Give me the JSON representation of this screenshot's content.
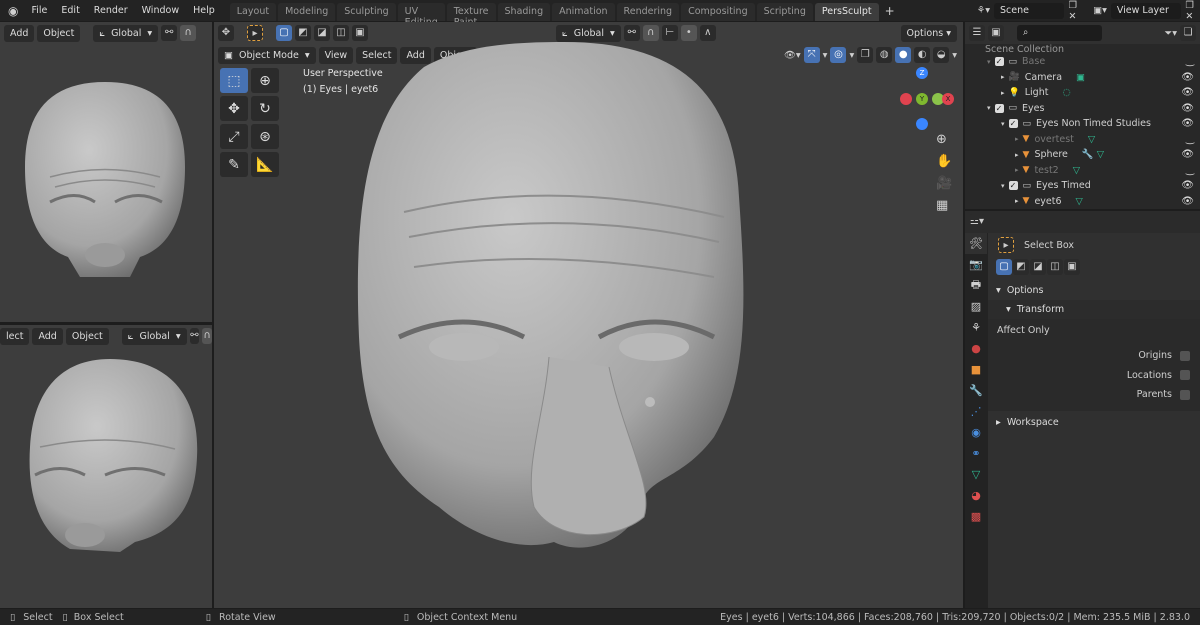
{
  "topbar": {
    "menus": [
      "File",
      "Edit",
      "Render",
      "Window",
      "Help"
    ],
    "workspaces": [
      "Layout",
      "Modeling",
      "Sculpting",
      "UV Editing",
      "Texture Paint",
      "Shading",
      "Animation",
      "Rendering",
      "Compositing",
      "Scripting",
      "PersSculpt"
    ],
    "active_workspace": "PersSculpt",
    "scene": "Scene",
    "view_layer": "View Layer"
  },
  "left_top": {
    "menus": [
      "Add",
      "Object"
    ],
    "orientation": "Global"
  },
  "left_bottom": {
    "menus": [
      "lect",
      "Add",
      "Object"
    ],
    "orientation": "Global"
  },
  "main": {
    "mode": "Object Mode",
    "menus": [
      "View",
      "Select",
      "Add",
      "Object"
    ],
    "orientation": "Global",
    "options": "Options",
    "overlay_title": "User Perspective",
    "overlay_sub": "(1) Eyes | eyet6",
    "gizmo": {
      "x": "X",
      "y": "Y",
      "z": "Z"
    }
  },
  "outliner": {
    "root": "Scene Collection",
    "items": [
      {
        "label": "Base",
        "depth": 1,
        "type": "collection",
        "dim": true,
        "visible": false
      },
      {
        "label": "Camera",
        "depth": 2,
        "type": "camera",
        "dim": false,
        "visible": true
      },
      {
        "label": "Light",
        "depth": 2,
        "type": "light",
        "dim": false,
        "visible": true
      },
      {
        "label": "Eyes",
        "depth": 1,
        "type": "collection",
        "dim": false,
        "visible": true
      },
      {
        "label": "Eyes Non Timed Studies",
        "depth": 2,
        "type": "collection",
        "dim": false,
        "visible": true
      },
      {
        "label": "overtest",
        "depth": 3,
        "type": "mesh",
        "dim": true,
        "visible": false
      },
      {
        "label": "Sphere",
        "depth": 3,
        "type": "mesh",
        "dim": false,
        "visible": true
      },
      {
        "label": "test2",
        "depth": 3,
        "type": "mesh",
        "dim": true,
        "visible": false
      },
      {
        "label": "Eyes Timed",
        "depth": 2,
        "type": "collection",
        "dim": false,
        "visible": true
      },
      {
        "label": "eyet6",
        "depth": 3,
        "type": "mesh",
        "dim": false,
        "visible": true
      }
    ]
  },
  "properties": {
    "tool": "Select Box",
    "options": "Options",
    "transform": "Transform",
    "affect_only": "Affect Only",
    "checks": [
      {
        "label": "Origins",
        "checked": false
      },
      {
        "label": "Locations",
        "checked": false
      },
      {
        "label": "Parents",
        "checked": false
      }
    ],
    "workspace": "Workspace"
  },
  "status": {
    "select": "Select",
    "box_select": "Box Select",
    "rotate": "Rotate View",
    "context": "Object Context Menu",
    "stats": "Eyes | eyet6 | Verts:104,866 | Faces:208,760 | Tris:209,720 | Objects:0/2 | Mem: 235.5 MiB | 2.83.0"
  },
  "colors": {
    "accent": "#4772b3",
    "viewport": "#3d3d3d",
    "mesh_icon": "#e8923a",
    "data_icon": "#2fb890"
  }
}
